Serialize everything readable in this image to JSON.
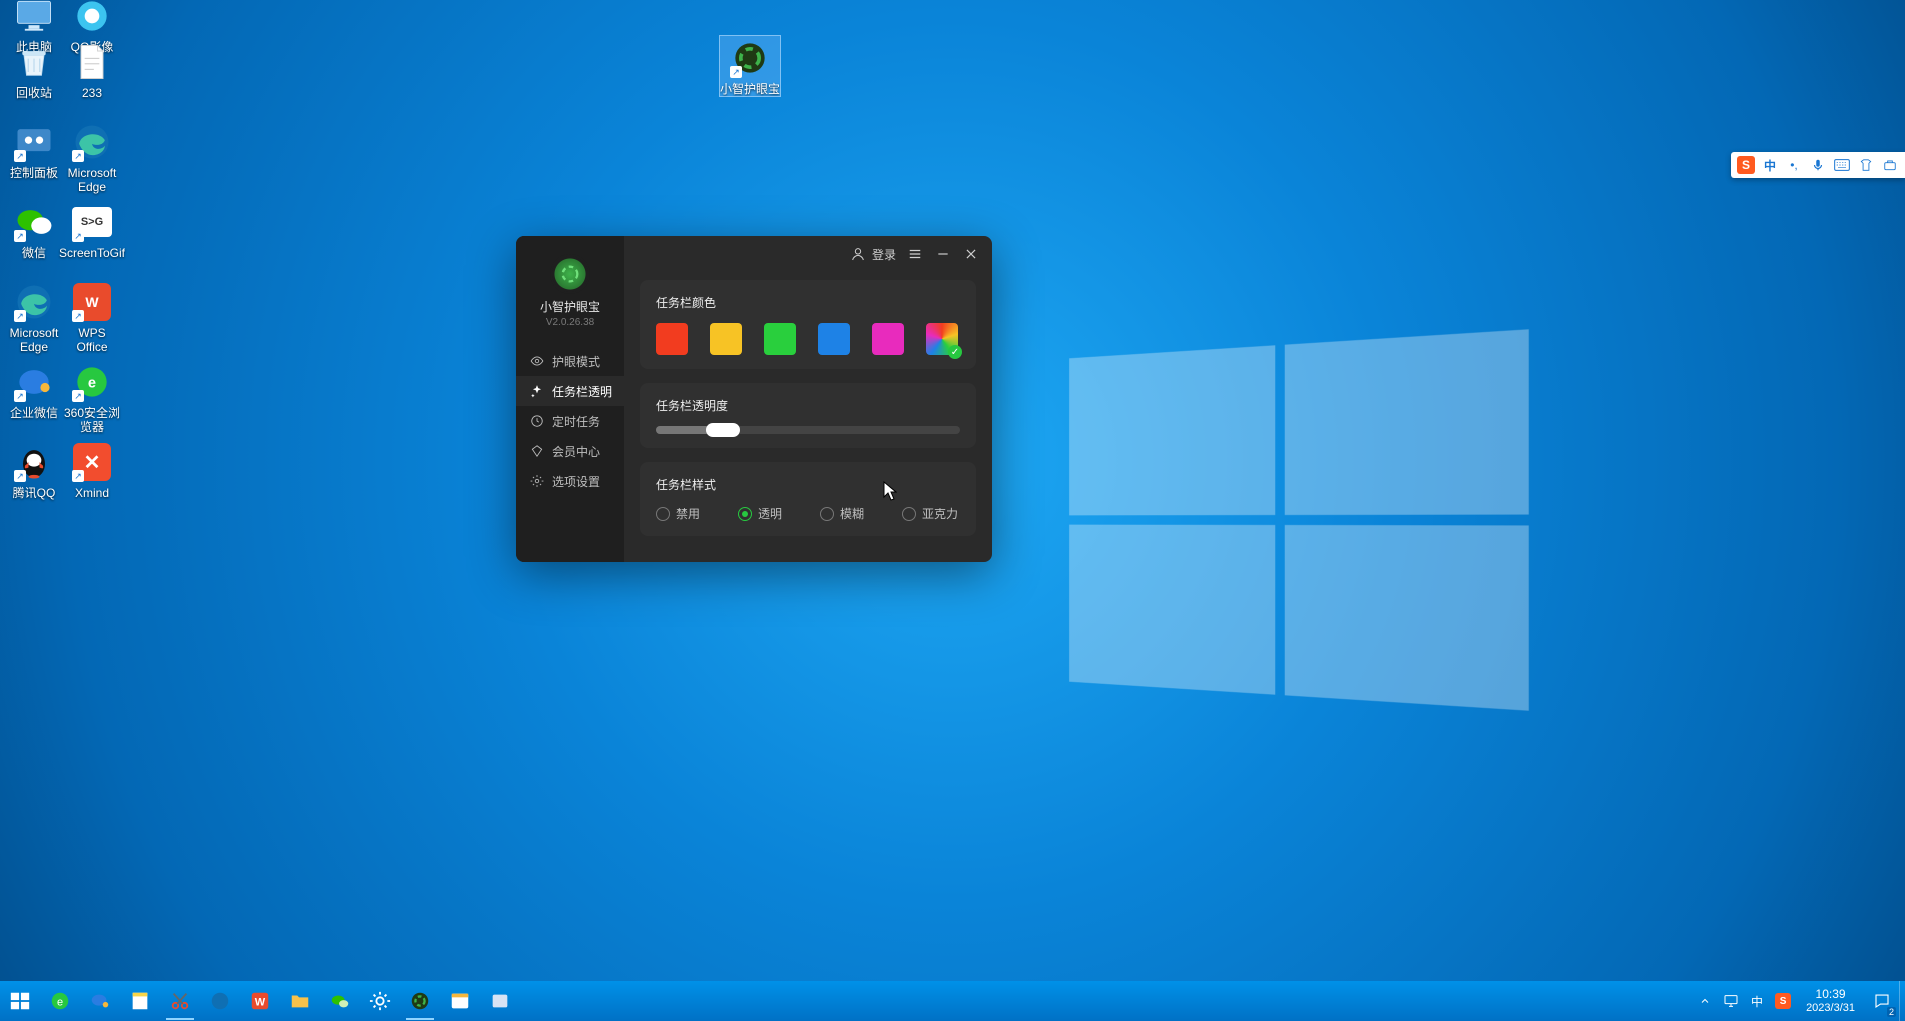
{
  "desktop_icons": {
    "this_pc": "此电脑",
    "qq_image": "QQ影像",
    "recycle": "回收站",
    "n233": "233",
    "control_panel": "控制面板",
    "edge": "Microsoft Edge",
    "wechat": "微信",
    "screentogif": "ScreenToGif",
    "edge2": "Microsoft Edge",
    "wps": "WPS Office",
    "qiye": "企业微信",
    "s360": "360安全浏览器",
    "qq": "腾讯QQ",
    "xmind": "Xmind",
    "eyecare": "小智护眼宝"
  },
  "app": {
    "name": "小智护眼宝",
    "version": "V2.0.26.38",
    "login": "登录",
    "nav": {
      "eye_mode": "护眼模式",
      "taskbar_trans": "任务栏透明",
      "timer": "定时任务",
      "vip": "会员中心",
      "settings": "选项设置"
    },
    "panel_color": {
      "title": "任务栏颜色",
      "colors": [
        "#f23c1f",
        "#f7c325",
        "#29cf3d",
        "#1e82e6",
        "#e82bbd",
        "multi"
      ],
      "selected_index": 5
    },
    "panel_opacity": {
      "title": "任务栏透明度",
      "value_percent": 22
    },
    "panel_style": {
      "title": "任务栏样式",
      "options": [
        "禁用",
        "透明",
        "模糊",
        "亚克力"
      ],
      "selected_index": 1
    }
  },
  "ime": {
    "lang": "中"
  },
  "tray": {
    "lang": "中"
  },
  "clock": {
    "time": "10:39",
    "date": "2023/3/31"
  },
  "action_center_badge": "2"
}
